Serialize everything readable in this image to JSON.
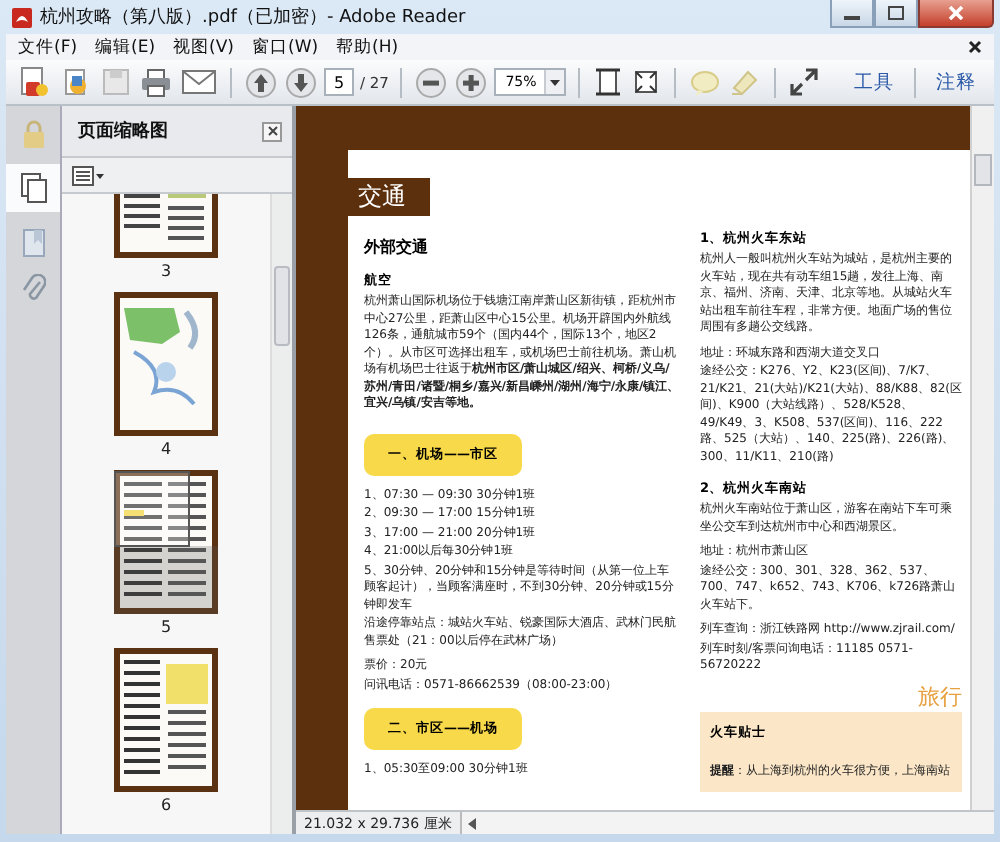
{
  "window": {
    "title": "杭州攻略（第八版）.pdf（已加密）- Adobe Reader"
  },
  "menu": [
    "文件(F)",
    "编辑(E)",
    "视图(V)",
    "窗口(W)",
    "帮助(H)"
  ],
  "toolbar": {
    "page": "5",
    "page_count": "/ 27",
    "zoom": "75%",
    "tabs": [
      "工具",
      "注释"
    ]
  },
  "nav_panel": {
    "title": "页面缩略图",
    "thumbnails": [
      {
        "label": "3",
        "kind": "photo",
        "selected": false
      },
      {
        "label": "4",
        "kind": "map",
        "selected": false
      },
      {
        "label": "5",
        "kind": "text",
        "selected": true
      },
      {
        "label": "6",
        "kind": "highlight",
        "selected": false
      }
    ]
  },
  "document": {
    "section_tab": "交通",
    "left_column": [
      {
        "kind": "heading",
        "text": "外部交通"
      },
      {
        "kind": "subheading",
        "text": "航空"
      },
      {
        "kind": "paragraph",
        "text": "杭州萧山国际机场位于钱塘江南岸萧山区新街镇，距杭州市中心27公里，距萧山区中心15公里。机场开辟国内外航线126条，通航城市59个（国内44个，国际13个，地区2个）。从市区可选择出租车，或机场巴士前往机场。萧山机场有机场巴士往返于**杭州市区/萧山城区/绍兴、柯桥/义乌/苏州/青田/诸暨/桐乡/嘉兴/新昌嵊州/湖州/海宁/永康/镇江、宜兴/乌镇/安吉等地。**"
      },
      {
        "kind": "callout",
        "text": "一、机场——市区"
      },
      {
        "kind": "line",
        "text": "1、07:30 — 09:30  30分钟1班"
      },
      {
        "kind": "line",
        "text": "2、09:30 — 17:00  15分钟1班"
      },
      {
        "kind": "line",
        "text": "3、17:00 — 21:00  20分钟1班"
      },
      {
        "kind": "line",
        "text": "4、21:00以后每30分钟1班"
      },
      {
        "kind": "line",
        "text": "5、30分钟、20分钟和15分钟是等待时间（从第一位上车顾客起计），当顾客满座时，不到30分钟、20分钟或15分钟即发车"
      },
      {
        "kind": "paragraph",
        "text": "沿途停靠站点：城站火车站、锐豪国际大酒店、武林门民航售票处（21：00以后停在武林广场）"
      },
      {
        "kind": "line",
        "text": "票价：20元"
      },
      {
        "kind": "line",
        "text": "问讯电话：0571-86662539（08:00-23:00）"
      },
      {
        "kind": "callout",
        "text": "二、市区——机场"
      },
      {
        "kind": "line",
        "text": "1、05:30至09:00  30分钟1班"
      }
    ],
    "right_column": [
      {
        "kind": "subheading",
        "text": "1、杭州火车东站"
      },
      {
        "kind": "paragraph",
        "text": "杭州人一般叫杭州火车站为城站，是杭州主要的火车站，现在共有动车组15趟，发往上海、南京、福州、济南、天津、北京等地。从城站火车站出租车前往车程，非常方便。地面广场的售位周围有多趟公交线路。"
      },
      {
        "kind": "line",
        "text": "地址：环城东路和西湖大道交叉口"
      },
      {
        "kind": "paragraph",
        "text": "途经公交：K276、Y2、K23(区间)、7/K7、21/K21、21(大站)/K21(大站)、88/K88、82(区间)、K900（大站线路）、528/K528、49/K49、3、K508、537(区间)、116、222路、525（大站）、140、225(路)、226(路)、300、11/K11、210(路)"
      },
      {
        "kind": "subheading",
        "text": "2、杭州火车南站"
      },
      {
        "kind": "paragraph",
        "text": "杭州火车南站位于萧山区，游客在南站下车可乘坐公交车到达杭州市中心和西湖景区。"
      },
      {
        "kind": "line",
        "text": "地址：杭州市萧山区"
      },
      {
        "kind": "paragraph",
        "text": "途经公交：300、301、328、362、537、700、747、k652、743、K706、k726路萧山火车站下。"
      },
      {
        "kind": "line",
        "text": "列车查询：浙江铁路网 http://www.zjrail.com/"
      },
      {
        "kind": "line",
        "text": "列车时刻/客票问询电话：11185  0571-56720222"
      }
    ],
    "tip": {
      "heading": "旅行",
      "title": "火车贴士",
      "text": "**提醒**：从上海到杭州的火车很方便，上海南站"
    }
  },
  "status_bar": {
    "page_size": "21.032 x 29.736 厘米"
  }
}
